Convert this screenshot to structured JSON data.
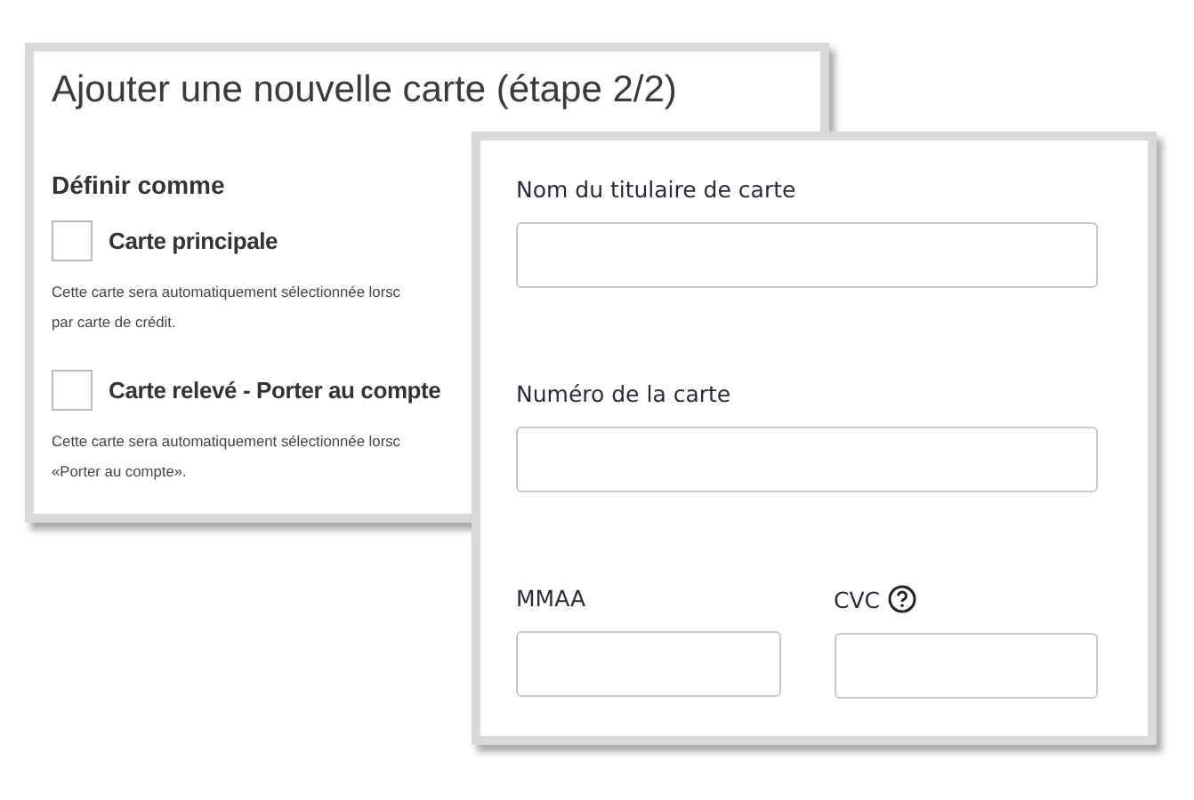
{
  "back_card": {
    "title": "Ajouter une nouvelle carte (étape 2/2)",
    "section_label": "Définir comme",
    "options": [
      {
        "label": "Carte principale",
        "checked": false,
        "description": [
          "Cette carte sera automatiquement sélectionnée lorsc",
          "par carte de crédit."
        ]
      },
      {
        "label": "Carte relevé - Porter au compte",
        "checked": false,
        "description": [
          "Cette carte sera automatiquement sélectionnée lorsc",
          "«Porter au compte»."
        ]
      }
    ]
  },
  "front_card": {
    "fields": [
      {
        "label": "Nom du titulaire de carte",
        "help": false
      },
      {
        "label": "Numéro de la carte",
        "help": false
      }
    ],
    "row_fields": [
      {
        "label": "MMAA",
        "help": false
      },
      {
        "label": "CVC",
        "help": true
      }
    ]
  }
}
